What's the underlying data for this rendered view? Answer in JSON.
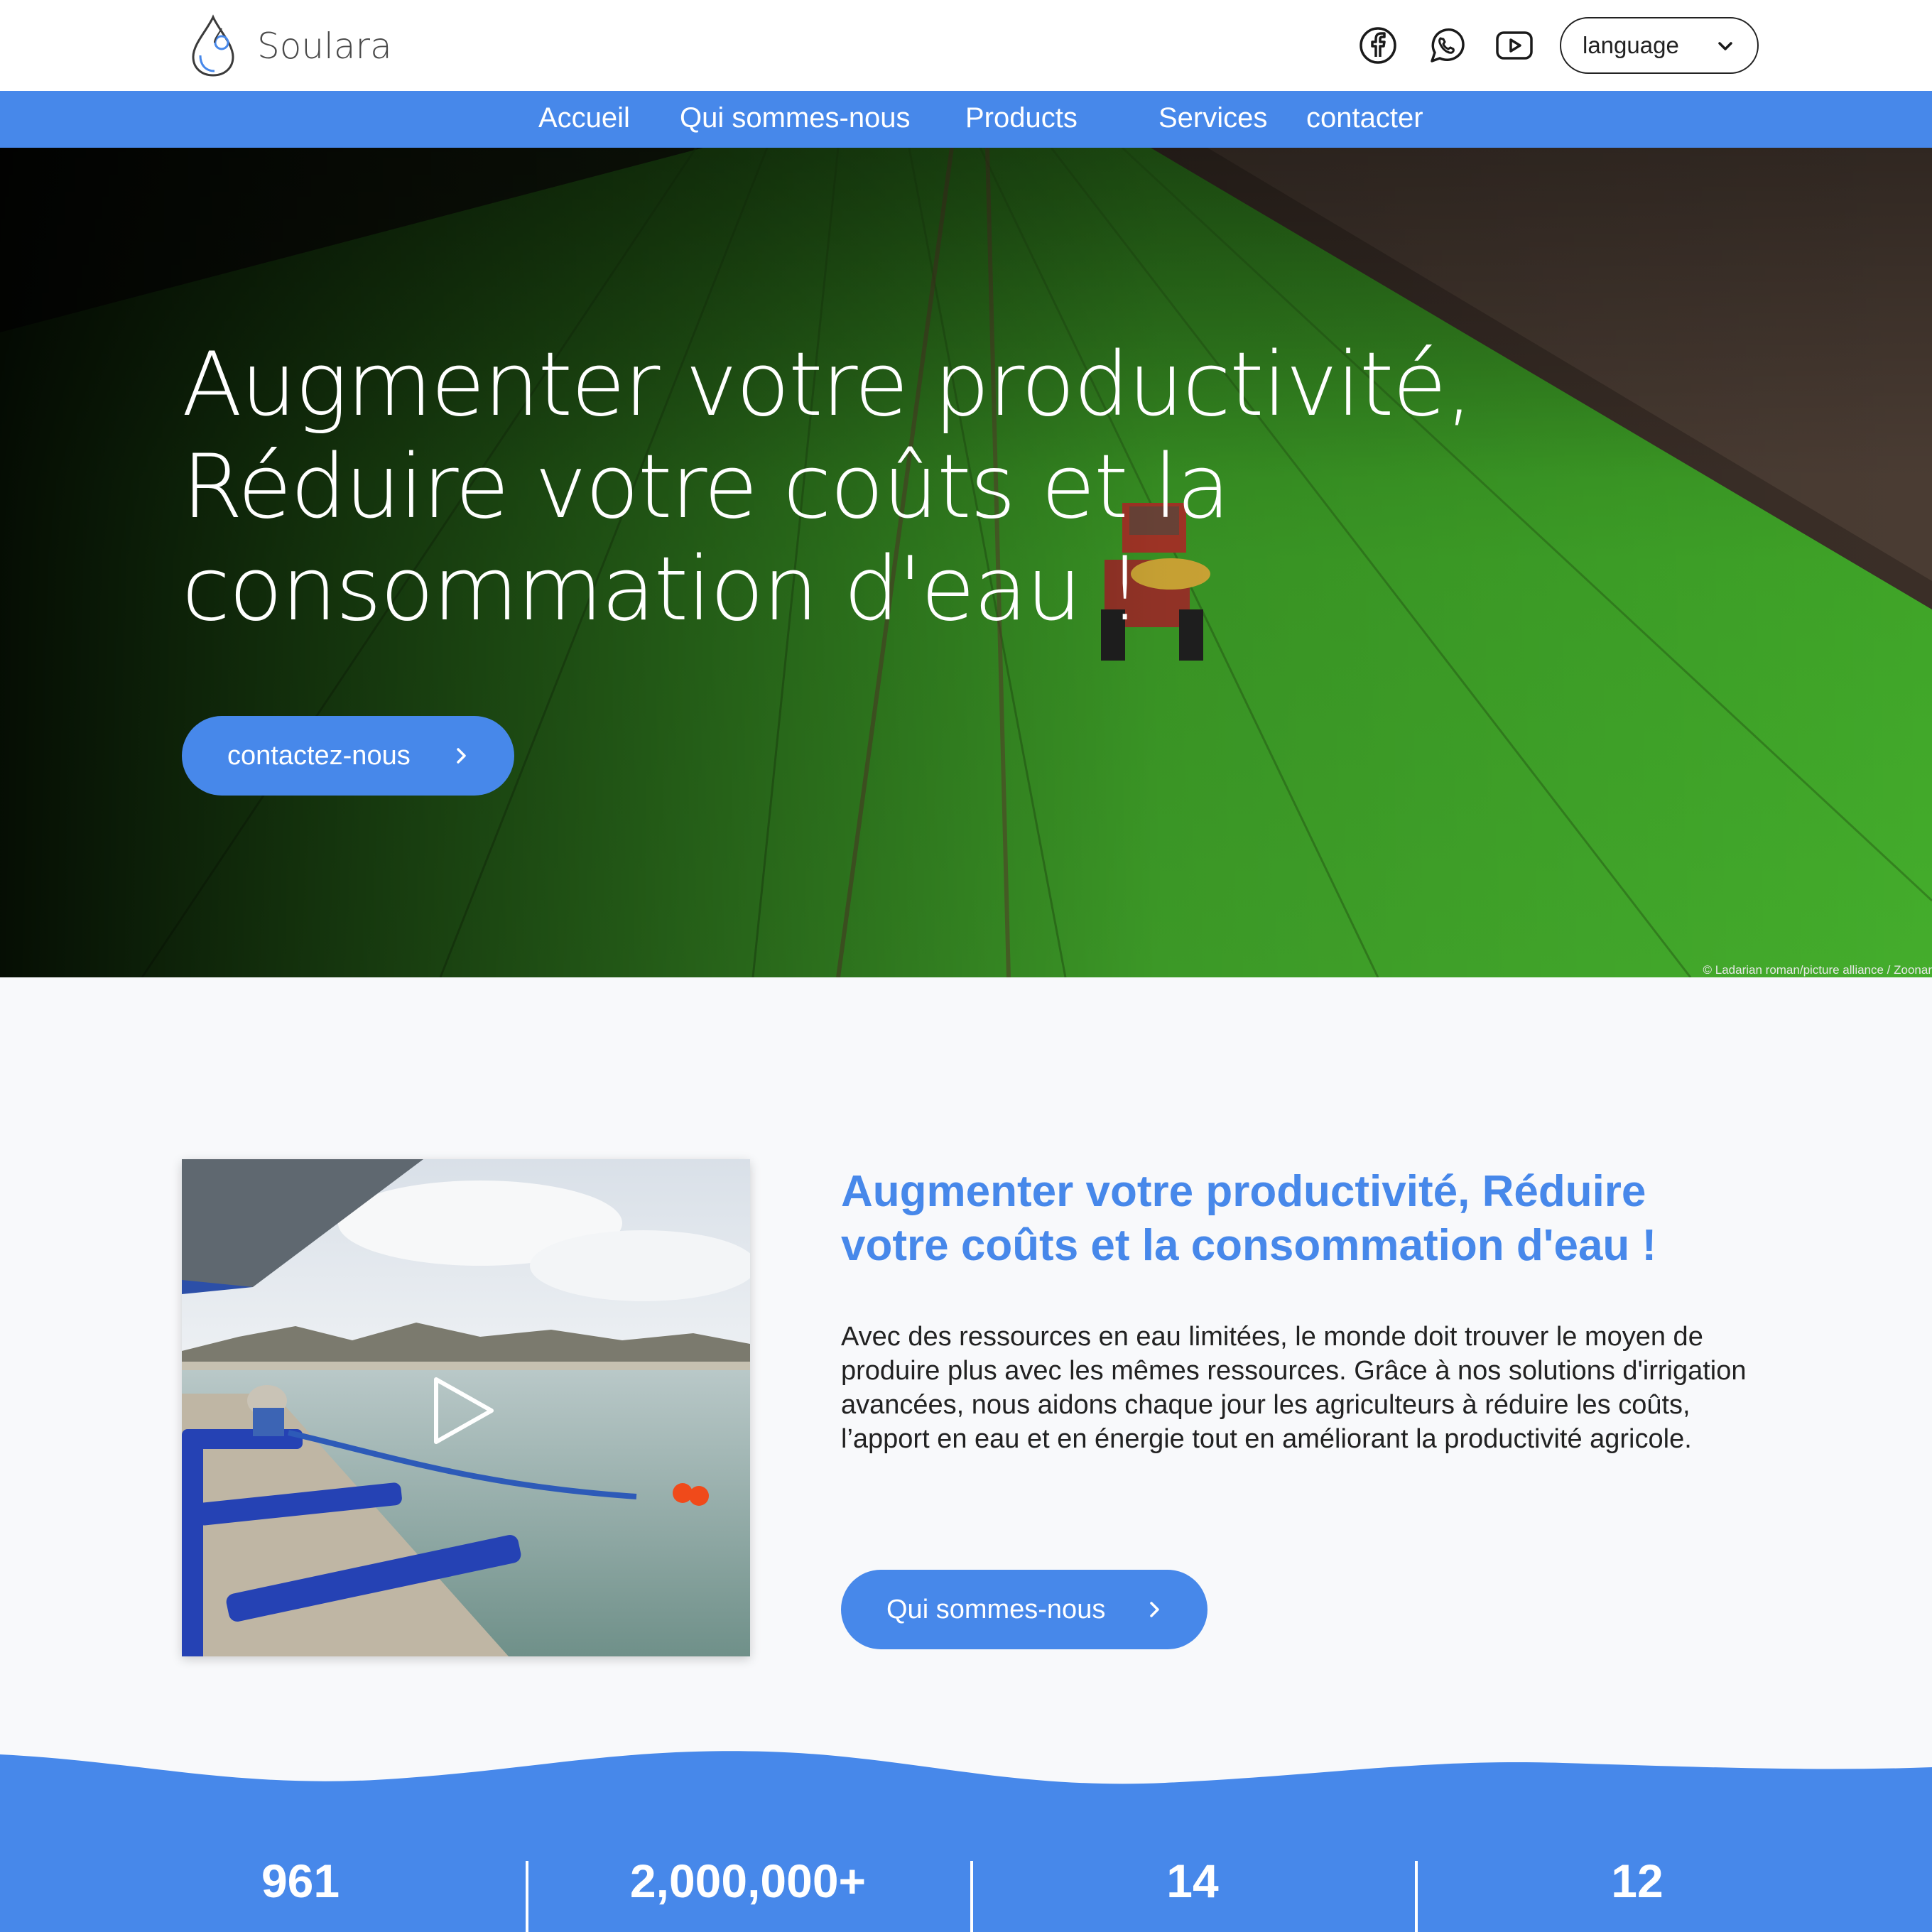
{
  "brand": {
    "name": "Soulara"
  },
  "header": {
    "language_label": "language"
  },
  "nav": {
    "items": [
      "Accueil",
      "Qui sommes-nous",
      "Products",
      "Services",
      "contacter"
    ]
  },
  "hero": {
    "title_lines": [
      "Augmenter votre productivité,",
      "Réduire votre coûts et la",
      "consommation d'eau !"
    ],
    "cta_label": "contactez-nous",
    "credit": "© Ladarian roman/picture alliance / Zoonar"
  },
  "about": {
    "title": "Augmenter votre productivité, Réduire votre coûts et la consommation d'eau !",
    "text": "Avec des ressources en eau limitées, le monde doit trouver le moyen de produire plus avec les mêmes ressources. Grâce à nos solutions d'irrigation avancées, nous aidons chaque jour les agriculteurs à réduire les coûts, l’apport en eau et en énergie tout en améliorant la productivité agricole.",
    "cta_label": "Qui sommes-nous"
  },
  "stats": {
    "values": [
      "961",
      "2,000,000+",
      "14",
      "12"
    ]
  },
  "colors": {
    "accent": "#4788ea",
    "header_bg": "#ffffff",
    "page_bg": "#f8f9fb"
  },
  "icons": {
    "social": [
      "facebook-icon",
      "whatsapp-icon",
      "youtube-icon"
    ],
    "logo": "water-drop-icon",
    "play": "play-icon",
    "chevron": "chevron-right-icon"
  }
}
